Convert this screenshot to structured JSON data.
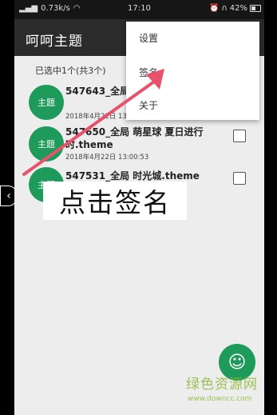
{
  "status_bar": {
    "speed": "0.73k/s",
    "time": "17:10",
    "battery": "42%"
  },
  "app_bar": {
    "title": "呵呵主题"
  },
  "selected_info": "已选中1个(共3个)",
  "items": [
    {
      "avatar": "主题",
      "name": "547643_全局 theme",
      "date": "2018年4月22日 13:00:49",
      "checked": false
    },
    {
      "avatar": "主题",
      "name": "547650_全局 萌星球 夏日进行时.theme",
      "date": "2018年4月22日 13:00:53",
      "checked": false
    },
    {
      "avatar": "主题",
      "name": "547531_全局 时光城.theme",
      "date": "",
      "checked": false
    }
  ],
  "menu": {
    "items": [
      "设置",
      "签名",
      "关于"
    ]
  },
  "annotation": "点击签名",
  "fab_icon": "smiley-icon",
  "watermark": {
    "text": "绿色资源网",
    "url": "www.downcc.com"
  },
  "colors": {
    "accent": "#1e9a5a",
    "appbar": "#2b2b2b",
    "arrow": "#e8526b"
  }
}
